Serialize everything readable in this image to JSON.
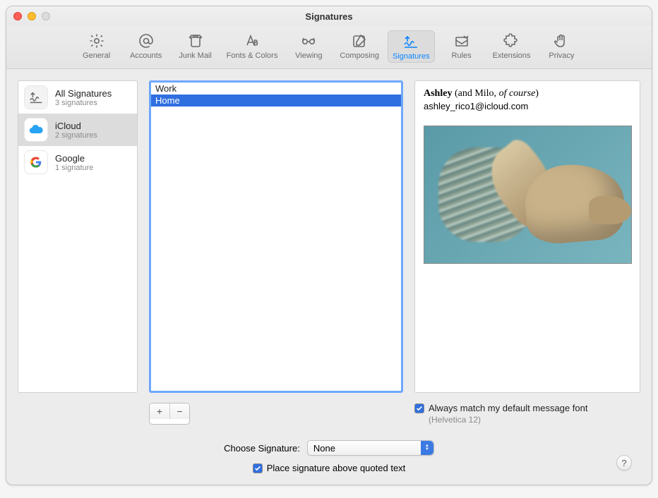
{
  "window": {
    "title": "Signatures"
  },
  "toolbar": [
    {
      "label": "General",
      "icon": "gear-icon",
      "selected": false
    },
    {
      "label": "Accounts",
      "icon": "at-icon",
      "selected": false
    },
    {
      "label": "Junk Mail",
      "icon": "trash-icon",
      "selected": false
    },
    {
      "label": "Fonts & Colors",
      "icon": "fonts-icon",
      "selected": false
    },
    {
      "label": "Viewing",
      "icon": "glasses-icon",
      "selected": false
    },
    {
      "label": "Composing",
      "icon": "compose-icon",
      "selected": false
    },
    {
      "label": "Signatures",
      "icon": "signature-icon",
      "selected": true
    },
    {
      "label": "Rules",
      "icon": "rules-icon",
      "selected": false
    },
    {
      "label": "Extensions",
      "icon": "puzzle-icon",
      "selected": false
    },
    {
      "label": "Privacy",
      "icon": "hand-icon",
      "selected": false
    }
  ],
  "accounts": [
    {
      "name": "All Signatures",
      "sub": "3 signatures",
      "icon": "signature-badge",
      "selected": false
    },
    {
      "name": "iCloud",
      "sub": "2 signatures",
      "icon": "icloud",
      "selected": true
    },
    {
      "name": "Google",
      "sub": "1 signature",
      "icon": "google",
      "selected": false
    }
  ],
  "signatures": [
    {
      "label": "Work",
      "selected": false
    },
    {
      "label": "Home",
      "selected": true
    }
  ],
  "preview": {
    "name_bold": "Ashley",
    "name_paren_prefix": " (and Milo, ",
    "name_ital": "of course",
    "name_paren_suffix": ")",
    "email": "ashley_rico1@icloud.com"
  },
  "buttons": {
    "plus": "+",
    "minus": "−"
  },
  "match_font": {
    "label": "Always match my default message font",
    "sub": "(Helvetica 12)",
    "checked": true
  },
  "choose": {
    "label": "Choose Signature:",
    "value": "None"
  },
  "place_above": {
    "label": "Place signature above quoted text",
    "checked": true
  },
  "help": "?"
}
